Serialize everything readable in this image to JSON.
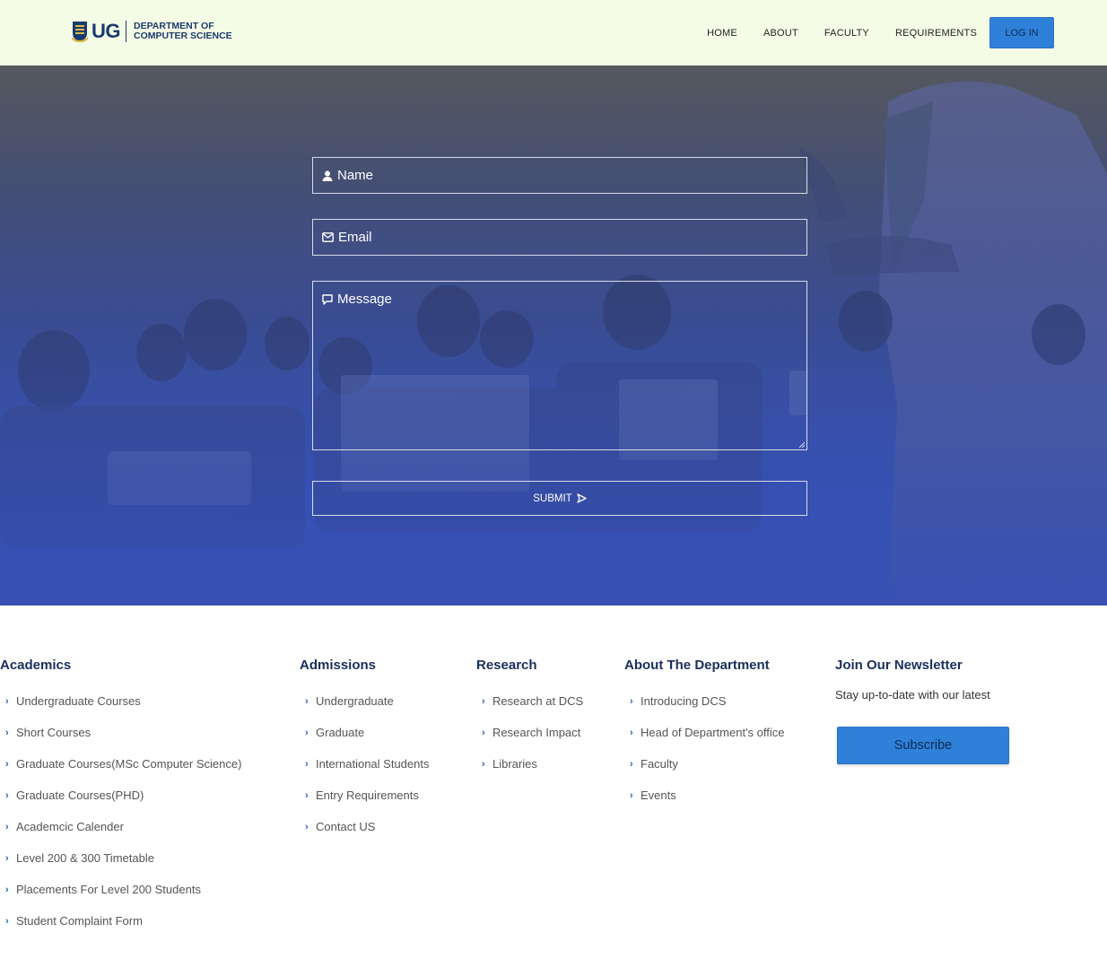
{
  "header": {
    "logo_short": "UG",
    "logo_dept_line1": "DEPARTMENT OF",
    "logo_dept_line2": "COMPUTER SCIENCE",
    "nav": [
      "HOME",
      "ABOUT",
      "FACULTY",
      "REQUIREMENTS"
    ],
    "login_label": "LOG IN"
  },
  "contact_form": {
    "name_placeholder": "Name",
    "email_placeholder": "Email",
    "message_placeholder": "Message",
    "submit_label": "SUBMIT"
  },
  "footer": {
    "academics": {
      "title": "Academics",
      "items": [
        "Undergraduate Courses",
        "Short Courses",
        "Graduate Courses(MSc Computer Science)",
        "Graduate Courses(PHD)",
        "Academcic Calender",
        "Level 200 & 300 Timetable",
        "Placements For Level 200 Students",
        "Student Complaint Form"
      ]
    },
    "admissions": {
      "title": "Admissions",
      "items": [
        "Undergraduate",
        "Graduate",
        "International Students",
        "Entry Requirements",
        "Contact US"
      ]
    },
    "research": {
      "title": "Research",
      "items": [
        "Research at DCS",
        "Research Impact",
        "Libraries"
      ]
    },
    "about": {
      "title": "About The Department",
      "items": [
        "Introducing DCS",
        "Head of Department's office",
        "Faculty",
        "Events"
      ]
    },
    "newsletter": {
      "title": "Join Our Newsletter",
      "text": "Stay up-to-date with our latest",
      "subscribe_label": "Subscribe"
    }
  },
  "colors": {
    "header_bg": "#f5fce6",
    "accent_button": "#2f80d8",
    "heading": "#1a2f5a",
    "hero_gradient_bottom": "#3650b4"
  }
}
